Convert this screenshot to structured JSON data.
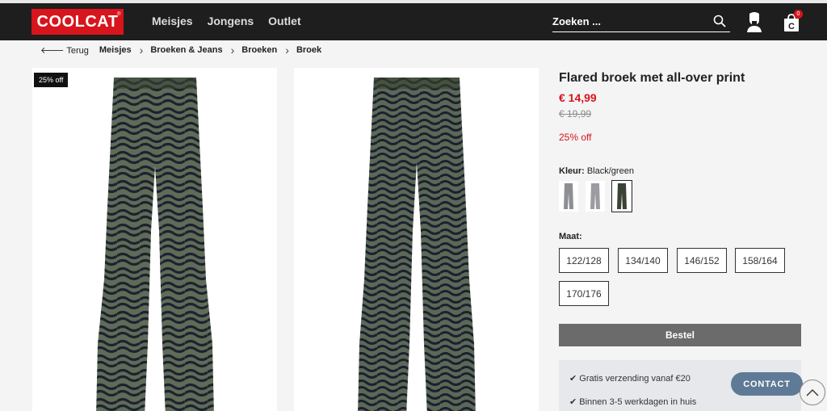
{
  "header": {
    "logo": "COOLCAT",
    "logo_mark": "®",
    "nav": [
      "Meisjes",
      "Jongens",
      "Outlet"
    ],
    "search_placeholder": "Zoeken ...",
    "cart_count": "0",
    "cart_letter": "C"
  },
  "breadcrumb": {
    "back": "Terug",
    "items": [
      "Meisjes",
      "Broeken & Jeans",
      "Broeken",
      "Broek"
    ]
  },
  "gallery": {
    "badge": "25% off"
  },
  "product": {
    "title": "Flared broek met all-over print",
    "price": "€ 14,99",
    "old_price": "€ 19,99",
    "discount": "25% off",
    "color_label": "Kleur:",
    "color_value": "Black/green",
    "size_label": "Maat:",
    "sizes": [
      "122/128",
      "134/140",
      "146/152",
      "158/164",
      "170/176"
    ],
    "order_label": "Bestel",
    "usps": [
      "✔ Gratis verzending vanaf €20",
      "✔ Binnen 3-5 werkdagen in huis"
    ]
  },
  "contact_label": "CONTACT",
  "colors": {
    "brand_red": "#d8141c",
    "header_bg": "#1e1e1e",
    "contact_bg": "#5e7a96"
  }
}
